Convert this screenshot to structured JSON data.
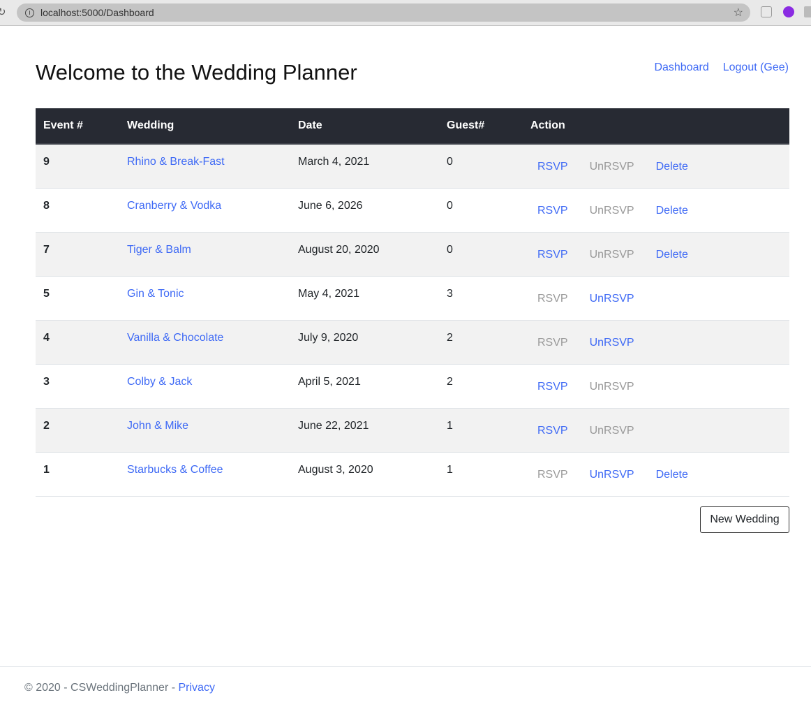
{
  "browser": {
    "url": "localhost:5000/Dashboard"
  },
  "header": {
    "title": "Welcome to the Wedding Planner",
    "nav": [
      "Dashboard",
      "Logout (Gee)"
    ]
  },
  "table": {
    "headers": [
      "Event #",
      "Wedding",
      "Date",
      "Guest#",
      "Action"
    ],
    "rows": [
      {
        "id": "9",
        "wedding": "Rhino & Break-Fast",
        "date": "March 4, 2021",
        "guests": "0",
        "rsvp": true,
        "unrsvp": false,
        "delete": true
      },
      {
        "id": "8",
        "wedding": "Cranberry & Vodka",
        "date": "June 6, 2026",
        "guests": "0",
        "rsvp": true,
        "unrsvp": false,
        "delete": true
      },
      {
        "id": "7",
        "wedding": "Tiger & Balm",
        "date": "August 20, 2020",
        "guests": "0",
        "rsvp": true,
        "unrsvp": false,
        "delete": true
      },
      {
        "id": "5",
        "wedding": "Gin & Tonic",
        "date": "May 4, 2021",
        "guests": "3",
        "rsvp": false,
        "unrsvp": true,
        "delete": false
      },
      {
        "id": "4",
        "wedding": "Vanilla & Chocolate",
        "date": "July 9, 2020",
        "guests": "2",
        "rsvp": false,
        "unrsvp": true,
        "delete": false
      },
      {
        "id": "3",
        "wedding": "Colby & Jack",
        "date": "April 5, 2021",
        "guests": "2",
        "rsvp": true,
        "unrsvp": false,
        "delete": false
      },
      {
        "id": "2",
        "wedding": "John & Mike",
        "date": "June 22, 2021",
        "guests": "1",
        "rsvp": true,
        "unrsvp": false,
        "delete": false
      },
      {
        "id": "1",
        "wedding": "Starbucks & Coffee",
        "date": "August 3, 2020",
        "guests": "1",
        "rsvp": false,
        "unrsvp": true,
        "delete": true
      }
    ]
  },
  "actions": {
    "rsvp": "RSVP",
    "unrsvp": "UnRSVP",
    "delete": "Delete"
  },
  "new_wedding": "New Wedding",
  "footer": {
    "text": "© 2020 - CSWeddingPlanner - ",
    "privacy": "Privacy"
  },
  "colors": {
    "link": "#3f6af5",
    "disabled": "#999999",
    "header_bg": "#272a33"
  }
}
